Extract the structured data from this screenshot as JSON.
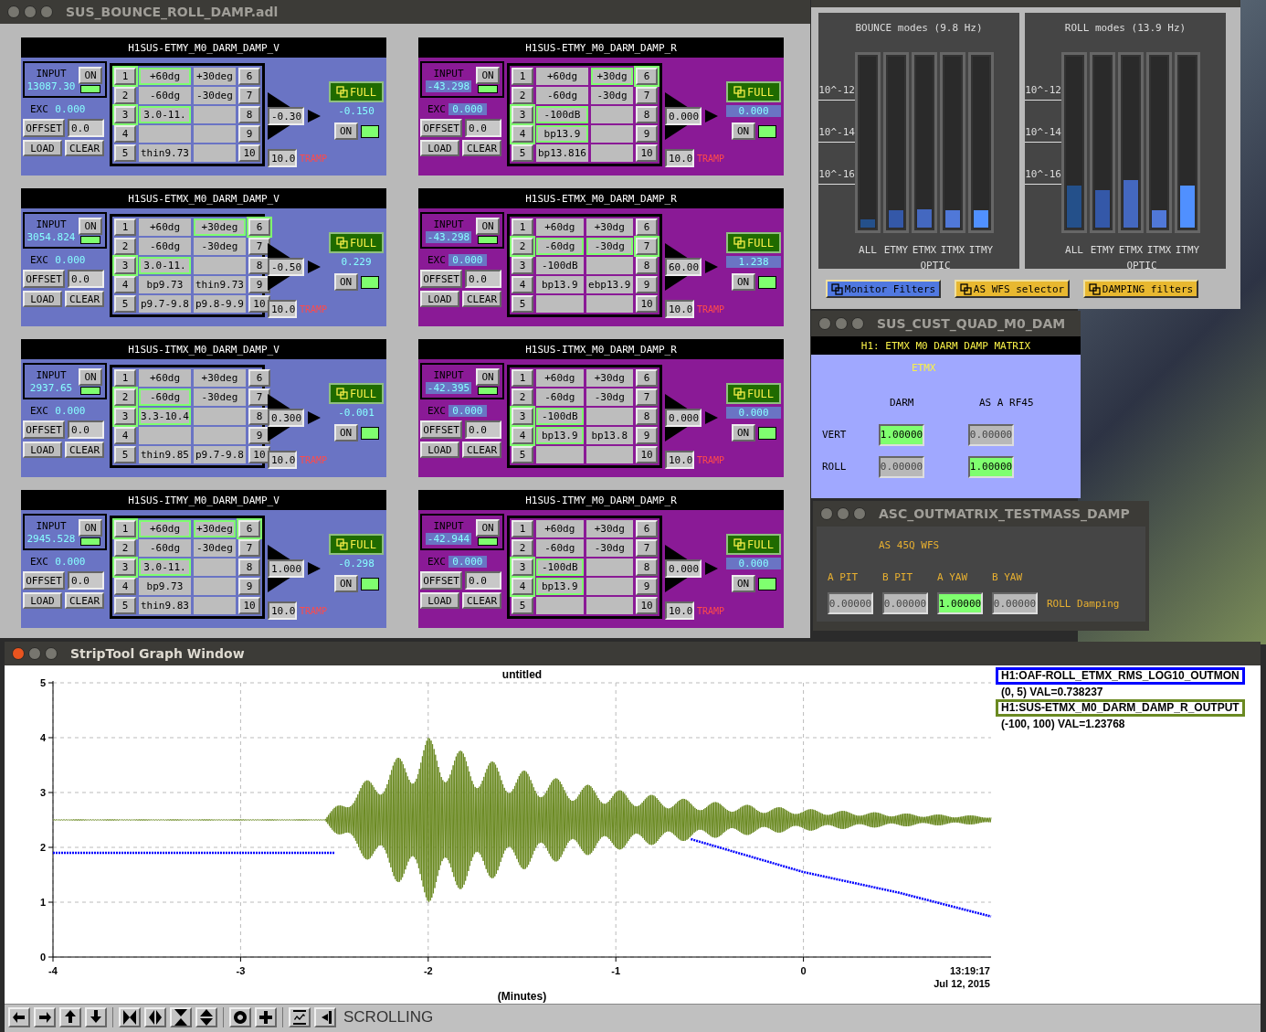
{
  "damp_window": {
    "title": "SUS_BOUNCE_ROLL_DAMP.adl",
    "modules": [
      {
        "title": "H1SUS-ETMY_M0_DARM_DAMP_V",
        "color": "#6a74c4",
        "input": {
          "label": "INPUT",
          "value": "13087.30",
          "button": "ON",
          "on": true
        },
        "exc": {
          "label": "EXC",
          "value": "0.000"
        },
        "offset": {
          "button": "OFFSET",
          "value": "0.0"
        },
        "load": "LOAD",
        "clear": "CLEAR",
        "filters": [
          {
            "number": "1",
            "name": "+60dg",
            "on": true
          },
          {
            "number": "2",
            "name": "-60dg",
            "on": false
          },
          {
            "number": "3",
            "name": "3.0-11.",
            "on": true
          },
          {
            "number": "4",
            "on": false
          },
          {
            "number": "5",
            "name": "thin9.73",
            "on": false
          },
          {
            "number": "6",
            "name": "+30deg",
            "on": false
          },
          {
            "number": "7",
            "name": "-30deg",
            "on": false
          },
          {
            "number": "8",
            "on": false
          },
          {
            "number": "9",
            "on": false
          },
          {
            "number": "10",
            "on": false
          }
        ],
        "gain": "-0.30",
        "ramp": {
          "value": "10.0",
          "label": "TRAMP"
        },
        "full": "FULL",
        "output": {
          "value": "-0.150",
          "button": "ON",
          "on": true
        }
      },
      {
        "title": "H1SUS-ETMY_M0_DARM_DAMP_R",
        "color": "#8a1a96",
        "input": {
          "label": "INPUT",
          "value": "-43.298",
          "button": "ON",
          "on": true
        },
        "exc": {
          "label": "EXC",
          "value": "0.000"
        },
        "offset": {
          "button": "OFFSET",
          "value": "0.0"
        },
        "load": "LOAD",
        "clear": "CLEAR",
        "filters": [
          {
            "number": "1",
            "name": "+60dg",
            "on": false
          },
          {
            "number": "2",
            "name": "-60dg",
            "on": false
          },
          {
            "number": "3",
            "name": "-100dB",
            "on": true
          },
          {
            "number": "4",
            "name": "bp13.9",
            "on": true
          },
          {
            "number": "5",
            "name": "bp13.816",
            "on": false
          },
          {
            "number": "6",
            "name": "+30dg",
            "on": true
          },
          {
            "number": "7",
            "name": "-30dg",
            "on": false
          },
          {
            "number": "8",
            "on": false
          },
          {
            "number": "9",
            "on": false
          },
          {
            "number": "10",
            "on": false
          }
        ],
        "gain": "0.000",
        "ramp": {
          "value": "10.0",
          "label": "TRAMP"
        },
        "full": "FULL",
        "output": {
          "value": "0.000",
          "button": "ON",
          "on": true
        }
      },
      {
        "title": "H1SUS-ETMX_M0_DARM_DAMP_V",
        "color": "#6a74c4",
        "input": {
          "label": "INPUT",
          "value": "3054.824",
          "button": "ON",
          "on": true
        },
        "exc": {
          "label": "EXC",
          "value": "0.000"
        },
        "offset": {
          "button": "OFFSET",
          "value": "0.0"
        },
        "load": "LOAD",
        "clear": "CLEAR",
        "filters": [
          {
            "number": "1",
            "name": "+60dg",
            "on": false
          },
          {
            "number": "2",
            "name": "-60dg",
            "on": false
          },
          {
            "number": "3",
            "name": "3.0-11.",
            "on": true
          },
          {
            "number": "4",
            "name": "bp9.73",
            "on": false
          },
          {
            "number": "5",
            "name": "p9.7-9.8",
            "on": false
          },
          {
            "number": "6",
            "name": "+30deg",
            "on": true
          },
          {
            "number": "7",
            "name": "-30deg",
            "on": false
          },
          {
            "number": "8",
            "on": false
          },
          {
            "number": "9",
            "name": "thin9.73",
            "on": false
          },
          {
            "number": "10",
            "name": "p9.8-9.9",
            "on": false
          }
        ],
        "gain": "-0.50",
        "ramp": {
          "value": "10.0",
          "label": "TRAMP"
        },
        "full": "FULL",
        "output": {
          "value": "0.229",
          "button": "ON",
          "on": true
        }
      },
      {
        "title": "H1SUS-ETMX_M0_DARM_DAMP_R",
        "color": "#8a1a96",
        "input": {
          "label": "INPUT",
          "value": "-43.298",
          "button": "ON",
          "on": true
        },
        "exc": {
          "label": "EXC",
          "value": "0.000"
        },
        "offset": {
          "button": "OFFSET",
          "value": "0.0"
        },
        "load": "LOAD",
        "clear": "CLEAR",
        "filters": [
          {
            "number": "1",
            "name": "+60dg",
            "on": false
          },
          {
            "number": "2",
            "name": "-60dg",
            "on": true
          },
          {
            "number": "3",
            "name": "-100dB",
            "on": false
          },
          {
            "number": "4",
            "name": "bp13.9",
            "on": false
          },
          {
            "number": "5",
            "on": false
          },
          {
            "number": "6",
            "name": "+30dg",
            "on": false
          },
          {
            "number": "7",
            "name": "-30dg",
            "on": true
          },
          {
            "number": "8",
            "on": false
          },
          {
            "number": "9",
            "name": "ebp13.9",
            "on": false
          },
          {
            "number": "10",
            "on": false
          }
        ],
        "gain": "60.00",
        "ramp": {
          "value": "10.0",
          "label": "TRAMP"
        },
        "full": "FULL",
        "output": {
          "value": "1.238",
          "button": "ON",
          "on": true
        }
      },
      {
        "title": "H1SUS-ITMX_M0_DARM_DAMP_V",
        "color": "#6a74c4",
        "input": {
          "label": "INPUT",
          "value": "2937.65",
          "button": "ON",
          "on": true
        },
        "exc": {
          "label": "EXC",
          "value": "0.000"
        },
        "offset": {
          "button": "OFFSET",
          "value": "0.0"
        },
        "load": "LOAD",
        "clear": "CLEAR",
        "filters": [
          {
            "number": "1",
            "name": "+60dg",
            "on": false
          },
          {
            "number": "2",
            "name": "-60dg",
            "on": true
          },
          {
            "number": "3",
            "name": "3.3-10.4",
            "on": true
          },
          {
            "number": "4",
            "on": false
          },
          {
            "number": "5",
            "name": "thin9.85",
            "on": false
          },
          {
            "number": "6",
            "name": "+30deg",
            "on": false
          },
          {
            "number": "7",
            "name": "-30deg",
            "on": false
          },
          {
            "number": "8",
            "on": false
          },
          {
            "number": "9",
            "on": false
          },
          {
            "number": "10",
            "name": "p9.7-9.8",
            "on": false
          }
        ],
        "gain": "0.300",
        "ramp": {
          "value": "10.0",
          "label": "TRAMP"
        },
        "full": "FULL",
        "output": {
          "value": "-0.001",
          "button": "ON",
          "on": true
        }
      },
      {
        "title": "H1SUS-ITMX_M0_DARM_DAMP_R",
        "color": "#8a1a96",
        "input": {
          "label": "INPUT",
          "value": "-42.395",
          "button": "ON",
          "on": true
        },
        "exc": {
          "label": "EXC",
          "value": "0.000"
        },
        "offset": {
          "button": "OFFSET",
          "value": "0.0"
        },
        "load": "LOAD",
        "clear": "CLEAR",
        "filters": [
          {
            "number": "1",
            "name": "+60dg",
            "on": false
          },
          {
            "number": "2",
            "name": "-60dg",
            "on": false
          },
          {
            "number": "3",
            "name": "-100dB",
            "on": true
          },
          {
            "number": "4",
            "name": "bp13.9",
            "on": true
          },
          {
            "number": "5",
            "on": false
          },
          {
            "number": "6",
            "name": "+30dg",
            "on": false
          },
          {
            "number": "7",
            "name": "-30dg",
            "on": false
          },
          {
            "number": "8",
            "on": false
          },
          {
            "number": "9",
            "name": "bp13.8",
            "on": false
          },
          {
            "number": "10",
            "on": false
          }
        ],
        "gain": "0.000",
        "ramp": {
          "value": "10.0",
          "label": "TRAMP"
        },
        "full": "FULL",
        "output": {
          "value": "0.000",
          "button": "ON",
          "on": true
        }
      },
      {
        "title": "H1SUS-ITMY_M0_DARM_DAMP_V",
        "color": "#6a74c4",
        "input": {
          "label": "INPUT",
          "value": "2945.528",
          "button": "ON",
          "on": true
        },
        "exc": {
          "label": "EXC",
          "value": "0.000"
        },
        "offset": {
          "button": "OFFSET",
          "value": "0.0"
        },
        "load": "LOAD",
        "clear": "CLEAR",
        "filters": [
          {
            "number": "1",
            "name": "+60dg",
            "on": true
          },
          {
            "number": "2",
            "name": "-60dg",
            "on": false
          },
          {
            "number": "3",
            "name": "3.0-11.",
            "on": true
          },
          {
            "number": "4",
            "name": "bp9.73",
            "on": false
          },
          {
            "number": "5",
            "name": "thin9.83",
            "on": false
          },
          {
            "number": "6",
            "name": "+30deg",
            "on": true
          },
          {
            "number": "7",
            "name": "-30deg",
            "on": false
          },
          {
            "number": "8",
            "on": false
          },
          {
            "number": "9",
            "on": false
          },
          {
            "number": "10",
            "on": false
          }
        ],
        "gain": "1.000",
        "ramp": {
          "value": "10.0",
          "label": "TRAMP"
        },
        "full": "FULL",
        "output": {
          "value": "-0.298",
          "button": "ON",
          "on": true
        }
      },
      {
        "title": "H1SUS-ITMY_M0_DARM_DAMP_R",
        "color": "#8a1a96",
        "input": {
          "label": "INPUT",
          "value": "-42.944",
          "button": "ON",
          "on": true
        },
        "exc": {
          "label": "EXC",
          "value": "0.000"
        },
        "offset": {
          "button": "OFFSET",
          "value": "0.0"
        },
        "load": "LOAD",
        "clear": "CLEAR",
        "filters": [
          {
            "number": "1",
            "name": "+60dg",
            "on": false
          },
          {
            "number": "2",
            "name": "-60dg",
            "on": false
          },
          {
            "number": "3",
            "name": "-100dB",
            "on": true
          },
          {
            "number": "4",
            "name": "bp13.9",
            "on": true
          },
          {
            "number": "5",
            "on": false
          },
          {
            "number": "6",
            "name": "+30dg",
            "on": false
          },
          {
            "number": "7",
            "name": "-30dg",
            "on": false
          },
          {
            "number": "8",
            "on": false
          },
          {
            "number": "9",
            "on": false
          },
          {
            "number": "10",
            "on": false
          }
        ],
        "gain": "0.000",
        "ramp": {
          "value": "10.0",
          "label": "TRAMP"
        },
        "full": "FULL",
        "output": {
          "value": "0.000",
          "button": "ON",
          "on": true
        }
      }
    ]
  },
  "monitor_window": {
    "groups": [
      {
        "title": "BOUNCE modes (9.8 Hz)",
        "ticks": [
          "10^-12",
          "10^-14",
          "10^-16"
        ],
        "axis_label": "OPTIC",
        "bars": [
          {
            "label": "ALL",
            "level": 0.05,
            "color": "#24508a"
          },
          {
            "label": "ETMY",
            "level": 0.1,
            "color": "#3458a8"
          },
          {
            "label": "ETMX",
            "level": 0.11,
            "color": "#4468c0"
          },
          {
            "label": "ITMX",
            "level": 0.1,
            "color": "#5078d8"
          },
          {
            "label": "ITMY",
            "level": 0.1,
            "color": "#5090ff"
          }
        ]
      },
      {
        "title": "ROLL modes (13.9 Hz)",
        "ticks": [
          "10^-12",
          "10^-14",
          "10^-16"
        ],
        "axis_label": "OPTIC",
        "bars": [
          {
            "label": "ALL",
            "level": 0.25,
            "color": "#24508a"
          },
          {
            "label": "ETMY",
            "level": 0.22,
            "color": "#3458a8"
          },
          {
            "label": "ETMX",
            "level": 0.28,
            "color": "#4468c0"
          },
          {
            "label": "ITMX",
            "level": 0.1,
            "color": "#5078d8"
          },
          {
            "label": "ITMY",
            "level": 0.25,
            "color": "#5090ff"
          }
        ]
      }
    ],
    "buttons": [
      {
        "label": "Monitor Filters",
        "color": "#5078e0"
      },
      {
        "label": "AS WFS selector",
        "color": "#e8b830"
      },
      {
        "label": "DAMPING filters",
        "color": "#e8b830"
      }
    ]
  },
  "matrix_window": {
    "title": "SUS_CUST_QUAD_M0_DAM",
    "header": "H1: ETMX M0 DARM DAMP MATRIX",
    "group": "ETMX",
    "columns": [
      "DARM",
      "AS A RF45"
    ],
    "rows": [
      {
        "label": "VERT",
        "cells": [
          {
            "value": "1.00000",
            "on": true
          },
          {
            "value": "0.00000",
            "on": false
          }
        ]
      },
      {
        "label": "ROLL",
        "cells": [
          {
            "value": "0.00000",
            "on": false
          },
          {
            "value": "1.00000",
            "on": true
          }
        ]
      }
    ]
  },
  "asc_window": {
    "title": "ASC_OUTMATRIX_TESTMASS_DAMP",
    "group": "AS 45Q WFS",
    "columns": [
      "A PIT",
      "B PIT",
      "A YAW",
      "B YAW"
    ],
    "cells": [
      {
        "value": "0.00000",
        "on": false
      },
      {
        "value": "0.00000",
        "on": false
      },
      {
        "value": "1.00000",
        "on": true
      },
      {
        "value": "0.00000",
        "on": false
      }
    ],
    "row_label": "ROLL Damping"
  },
  "strip_window": {
    "title": "StripTool Graph Window",
    "chart_data": {
      "type": "line",
      "title": "untitled",
      "xlabel": "(Minutes)",
      "x": [
        -4,
        -3.5,
        -3,
        -2.5,
        -2,
        -1.5,
        -1,
        -0.6,
        -0.5,
        0,
        0.5,
        1
      ],
      "series": [
        {
          "color": "#0000ff",
          "line_style": "dotted",
          "values": [
            1.9,
            1.9,
            1.9,
            1.9,
            null,
            null,
            null,
            2.15,
            2.05,
            1.55,
            1.18,
            0.74
          ]
        }
      ],
      "xlim": [
        -4,
        1
      ],
      "ylim": [
        0,
        5
      ],
      "grid": true,
      "xticks": [
        -4,
        -3,
        -2,
        -1,
        0
      ],
      "yticks": [
        0,
        1,
        2,
        3,
        4,
        5
      ]
    },
    "legend": [
      {
        "name": "H1:OAF-ROLL_ETMX_RMS_LOG10_OUTMON",
        "readout": "(0, 5) VAL=0.738237",
        "color": "#0000ff"
      },
      {
        "name": "H1:SUS-ETMX_M0_DARM_DAMP_R_OUTPUT",
        "readout": "(-100, 100) VAL=1.23768",
        "color": "#6b8a22"
      }
    ],
    "timestamp": {
      "time": "13:19:17",
      "date": "Jul 12, 2015"
    },
    "mode": "SCROLLING"
  }
}
